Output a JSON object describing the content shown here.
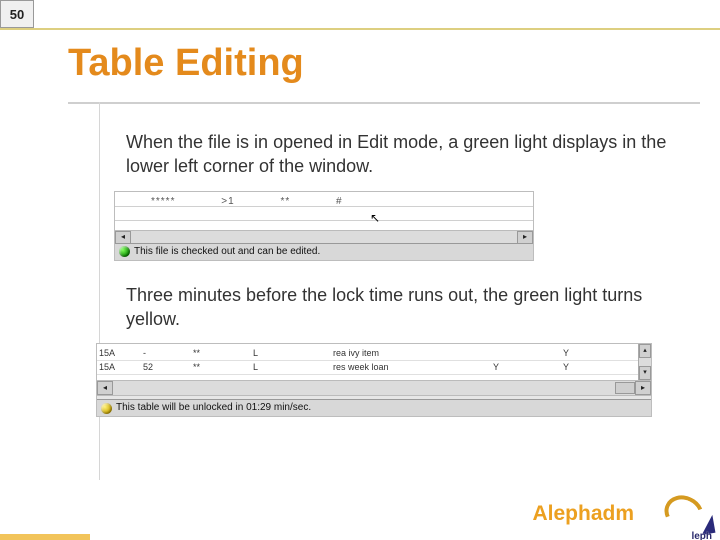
{
  "slide_number": "50",
  "title": "Table Editing",
  "para1": "When  the file is in opened in Edit mode, a green light displays in the lower left corner of the window.",
  "para2": "Three minutes before the lock time runs out, the green light turns yellow.",
  "shot1": {
    "placeholder1": "*****",
    "placeholder2": ">1",
    "placeholder3": "**",
    "placeholder4": "#",
    "status": "This file is checked out and can be edited."
  },
  "shot2": {
    "row1": {
      "c1": "15A",
      "c2": "-",
      "c3": "**",
      "c4": "L",
      "c5": "rea ivy item",
      "c6": "",
      "c7": "Y"
    },
    "row2": {
      "c1": "15A",
      "c2": "52",
      "c3": "**",
      "c4": "L",
      "c5": "res week loan",
      "c6": "Y",
      "c7": "Y"
    },
    "status": "This table will be unlocked in 01:29 min/sec."
  },
  "footer": "Alephadm",
  "logo_text": "leph"
}
